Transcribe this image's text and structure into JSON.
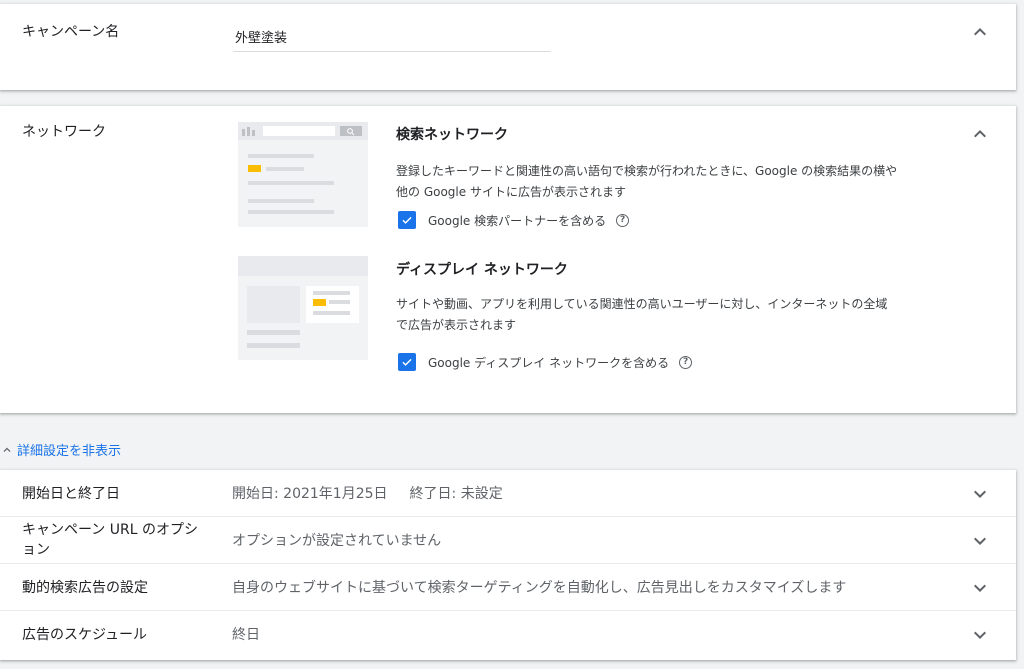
{
  "campaign_name": {
    "label": "キャンペーン名",
    "value": "外壁塗装"
  },
  "network": {
    "label": "ネットワーク",
    "search": {
      "title": "検索ネットワーク",
      "desc_line1": "登録したキーワードと関連性の高い語句で検索が行われたときに、Google の検索結果の横や",
      "desc_line2": "他の Google サイトに広告が表示されます",
      "checkbox_label": "Google 検索パートナーを含める",
      "checked": true
    },
    "display": {
      "title": "ディスプレイ ネットワーク",
      "desc_line1": "サイトや動画、アプリを利用している関連性の高いユーザーに対し、インターネットの全域",
      "desc_line2": "で広告が表示されます",
      "checkbox_label": "Google ディスプレイ ネットワークを含める",
      "checked": true
    }
  },
  "advanced_toggle": "詳細設定を非表示",
  "settings": {
    "dates": {
      "label": "開始日と終了日",
      "start": "開始日: 2021年1月25日",
      "end": "終了日: 未設定"
    },
    "url_options": {
      "label_line1": "キャンペーン URL のオプシ",
      "label_line2": "ョン",
      "value": "オプションが設定されていません"
    },
    "dsa": {
      "label": "動的検索広告の設定",
      "value": "自身のウェブサイトに基づいて検索ターゲティングを自動化し、広告見出しをカスタマイズします"
    },
    "schedule": {
      "label": "広告のスケジュール",
      "value": "終日"
    }
  },
  "help_glyph": "?",
  "colors": {
    "accent": "#1a73e8",
    "highlight": "#fbbc04"
  },
  "icons": [
    "chevron-up-icon",
    "chevron-down-icon",
    "check-icon",
    "help-icon",
    "search-icon"
  ]
}
